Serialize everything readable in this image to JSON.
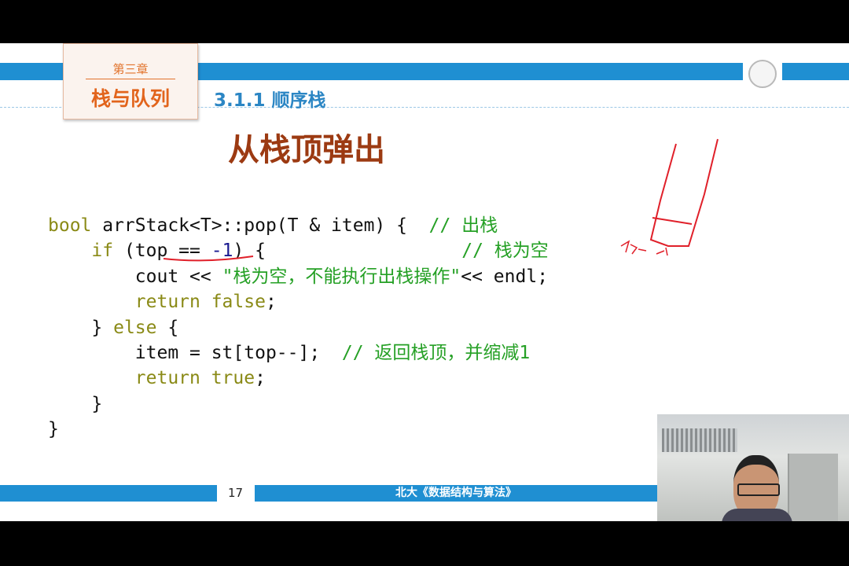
{
  "slide": {
    "chapter_label": "第三章",
    "chapter_title": "栈与队列",
    "section": "3.1.1  顺序栈",
    "title": "从栈顶弹出",
    "code_lines": [
      [
        {
          "t": "bool",
          "c": "kw"
        },
        {
          "t": " arrStack<T>::pop(T & item) {  "
        },
        {
          "t": "// 出栈",
          "c": "cm"
        }
      ],
      [
        {
          "t": "    "
        },
        {
          "t": "if",
          "c": "kw"
        },
        {
          "t": " (top == "
        },
        {
          "t": "-1",
          "c": "num"
        },
        {
          "t": ") {                  "
        },
        {
          "t": "// 栈为空",
          "c": "cm"
        }
      ],
      [
        {
          "t": "        cout << "
        },
        {
          "t": "\"栈为空，不能执行出栈操作\"",
          "c": "cm"
        },
        {
          "t": "<< endl;"
        }
      ],
      [
        {
          "t": "        "
        },
        {
          "t": "return false",
          "c": "kw"
        },
        {
          "t": ";"
        }
      ],
      [
        {
          "t": "    } "
        },
        {
          "t": "else",
          "c": "kw"
        },
        {
          "t": " {"
        }
      ],
      [
        {
          "t": "        item = st[top--];  "
        },
        {
          "t": "// 返回栈顶，并缩减1",
          "c": "cm"
        }
      ],
      [
        {
          "t": "        "
        },
        {
          "t": "return true",
          "c": "kw"
        },
        {
          "t": ";"
        }
      ],
      [
        {
          "t": "    }"
        }
      ],
      [
        {
          "t": "}"
        }
      ]
    ],
    "page_number": "17",
    "footer": "北大《数据结构与算法》",
    "colors": {
      "accent_blue": "#1f8fd2",
      "chapter_orange": "#e2641c",
      "title_brown": "#9c3a12",
      "annotation_red": "#e0202a"
    }
  }
}
